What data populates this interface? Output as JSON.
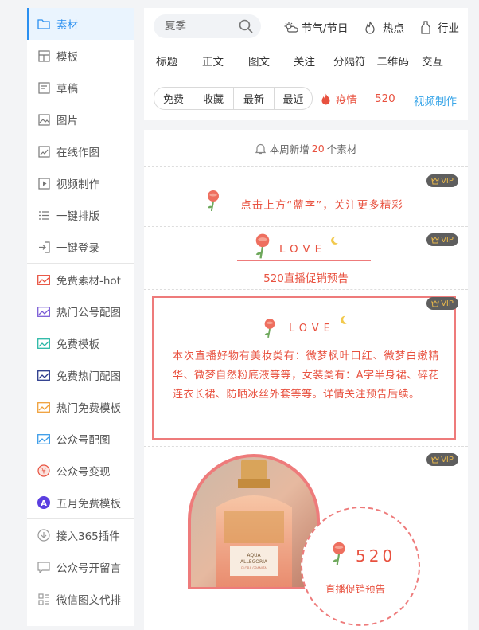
{
  "sidebar": {
    "items": [
      {
        "label": "素材",
        "icon": "folder-icon",
        "active": true
      },
      {
        "label": "模板",
        "icon": "template-icon"
      },
      {
        "label": "草稿",
        "icon": "draft-icon"
      },
      {
        "label": "图片",
        "icon": "image-icon"
      },
      {
        "label": "在线作图",
        "icon": "online-design-icon"
      },
      {
        "label": "视频制作",
        "icon": "video-icon"
      },
      {
        "label": "一键排版",
        "icon": "list-icon"
      },
      {
        "label": "一键登录",
        "icon": "login-icon"
      },
      {
        "label": "免费素材-hot",
        "icon": "chart-icon",
        "color": "#e8513f"
      },
      {
        "label": "热门公号配图",
        "icon": "chart-icon",
        "color": "#7b5cd6"
      },
      {
        "label": "免费模板",
        "icon": "chart-icon",
        "color": "#2ab8a6"
      },
      {
        "label": "免费热门配图",
        "icon": "chart-icon",
        "color": "#2b3a8c"
      },
      {
        "label": "热门免费模板",
        "icon": "chart-icon",
        "color": "#f0a03a"
      },
      {
        "label": "公众号配图",
        "icon": "chart-icon",
        "color": "#3a9be8"
      },
      {
        "label": "公众号变现",
        "icon": "monetize-icon",
        "color": "#e8513f"
      },
      {
        "label": "五月免费模板",
        "icon": "badge-a-icon",
        "color": "#5b3fe0"
      },
      {
        "label": "接入365插件",
        "icon": "plugin-icon"
      },
      {
        "label": "公众号开留言",
        "icon": "comment-icon"
      },
      {
        "label": "微信图文代排",
        "icon": "grid-icon"
      }
    ]
  },
  "search": {
    "placeholder": "夏季"
  },
  "categories": [
    "节气/节日",
    "热点",
    "行业"
  ],
  "tabs": [
    "标题",
    "正文",
    "图文",
    "关注",
    "分隔符",
    "二维码",
    "交互"
  ],
  "filters": [
    "免费",
    "收藏",
    "最新",
    "最近"
  ],
  "hot_tag": "疫情",
  "tag_520": "520",
  "video_link": "视频制作",
  "feed": {
    "weekly_prefix": "本周新增",
    "weekly_count": "20",
    "weekly_suffix": "个素材",
    "vip": "VIP",
    "card1_text": "点击上方“蓝字”，关注更多精彩",
    "love": "LOVE",
    "card2_title": "520直播促销预告",
    "card3_text": "本次直播好物有美妆类有：微梦枫叶口红、微梦白嫩精华、微梦自然粉底液等等，女装类有：A字半身裙、碎花连衣长裙、防晒冰丝外套等等。详情关注预告后续。",
    "card4_num": "520",
    "card4_sub": "直播促销预告",
    "perfume_label_1": "AQUA",
    "perfume_label_2": "ALLEGORIA",
    "perfume_label_3": "FLORA GRANITA"
  },
  "colors": {
    "accent": "#2a8ff0",
    "red": "#e8513f",
    "pink": "#ee7b7b"
  }
}
